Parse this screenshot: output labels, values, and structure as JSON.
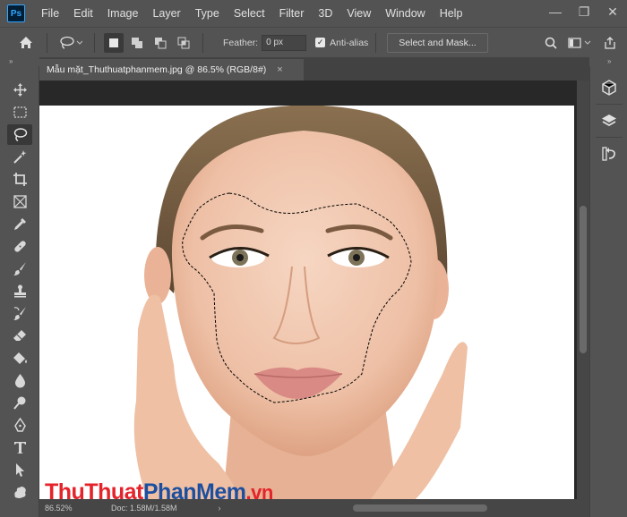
{
  "app": {
    "logo_text": "Ps"
  },
  "menu": [
    "File",
    "Edit",
    "Image",
    "Layer",
    "Type",
    "Select",
    "Filter",
    "3D",
    "View",
    "Window",
    "Help"
  ],
  "window_controls": {
    "minimize": "—",
    "maximize": "❐",
    "close": "✕"
  },
  "options": {
    "feather_label": "Feather:",
    "feather_value": "0 px",
    "antialias_label": "Anti-alias",
    "antialias_checked": true,
    "select_mask_label": "Select and Mask..."
  },
  "document": {
    "tab_title": "Mẫu mặt_Thuthuatphanmem.jpg @ 86.5% (RGB/8#)",
    "close_glyph": "×"
  },
  "status": {
    "zoom": "86.52%",
    "doc_info": "Doc: 1.58M/1.58M",
    "arrow": "›"
  },
  "panel_collapse_glyph": "»",
  "tools": [
    {
      "name": "move-tool",
      "icon": "move-icon"
    },
    {
      "name": "marquee-tool",
      "icon": "marquee-icon"
    },
    {
      "name": "lasso-tool",
      "icon": "lasso-icon",
      "active": true
    },
    {
      "name": "magic-wand-tool",
      "icon": "magic-wand-icon"
    },
    {
      "name": "crop-tool",
      "icon": "crop-icon"
    },
    {
      "name": "frame-tool",
      "icon": "frame-icon"
    },
    {
      "name": "eyedropper-tool",
      "icon": "eyedropper-icon"
    },
    {
      "name": "healing-brush-tool",
      "icon": "bandage-icon"
    },
    {
      "name": "brush-tool",
      "icon": "brush-icon"
    },
    {
      "name": "clone-stamp-tool",
      "icon": "stamp-icon"
    },
    {
      "name": "history-brush-tool",
      "icon": "history-brush-icon"
    },
    {
      "name": "eraser-tool",
      "icon": "eraser-icon"
    },
    {
      "name": "paint-bucket-tool",
      "icon": "bucket-icon"
    },
    {
      "name": "blur-tool",
      "icon": "drop-icon"
    },
    {
      "name": "dodge-tool",
      "icon": "dodge-icon"
    },
    {
      "name": "pen-tool",
      "icon": "pen-icon"
    },
    {
      "name": "type-tool",
      "icon": "type-icon"
    },
    {
      "name": "path-selection-tool",
      "icon": "arrow-icon"
    },
    {
      "name": "custom-shape-tool",
      "icon": "shape-icon"
    }
  ],
  "watermark": {
    "part1": "Thu",
    "part2": "Thuat",
    "part3": "Phan",
    "part4": "Mem",
    "part5": ".vn"
  },
  "colors": {
    "ui": "#535353",
    "dark": "#424242",
    "canvas_bg": "#282828",
    "wm_red": "#e5232a",
    "wm_blue": "#1d4fa0"
  }
}
